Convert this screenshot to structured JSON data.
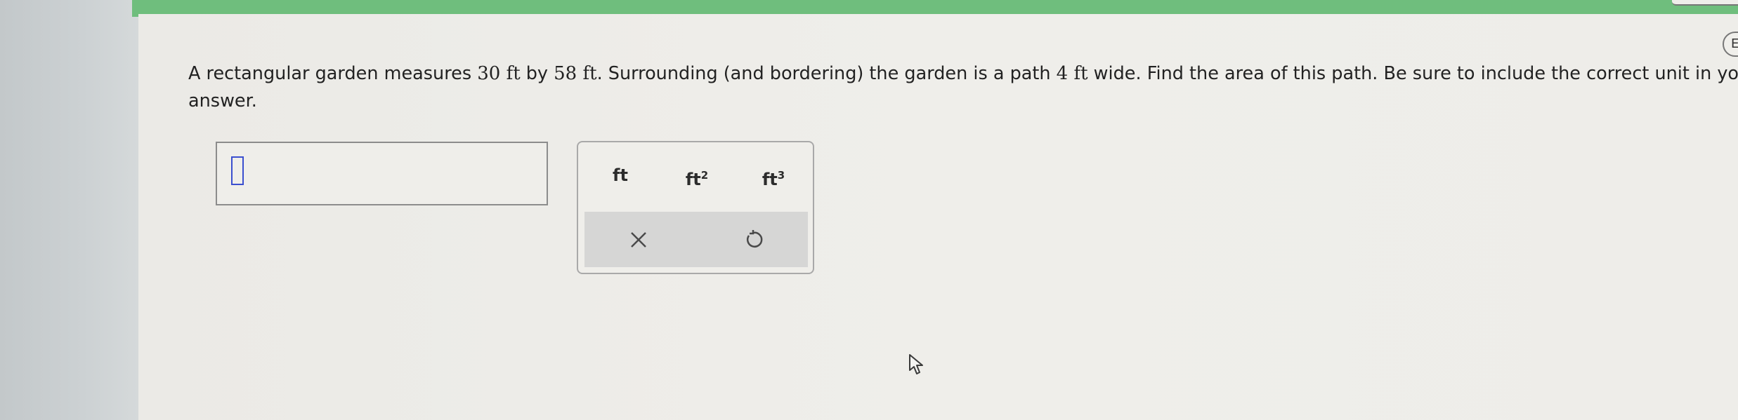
{
  "question": {
    "seg1": "A rectangular garden measures ",
    "m1": "30 ft",
    "seg2": " by ",
    "m2": "58 ft",
    "seg3": ". Surrounding (and bordering) the garden is a path ",
    "m3": "4 ft",
    "seg4": " wide. Find the area of this path. Be sure to include the correct unit in your answer."
  },
  "answer": {
    "value": ""
  },
  "units": {
    "ft": "ft",
    "ft2_base": "ft",
    "ft2_exp": "2",
    "ft3_base": "ft",
    "ft3_exp": "3"
  },
  "actions": {
    "clear_icon": "close-icon",
    "undo_icon": "undo-icon"
  },
  "edge_button": {
    "label": "E"
  },
  "colors": {
    "top_bar": "#6fbe7d",
    "cursor": "#3b4fcf"
  }
}
